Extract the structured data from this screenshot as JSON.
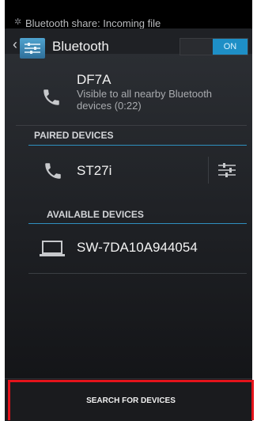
{
  "notification": {
    "text": "Bluetooth share: Incoming file",
    "icon": "bluetooth-share-icon"
  },
  "actionbar": {
    "title": "Bluetooth",
    "toggle_label": "ON",
    "icon": "bluetooth-settings-icon"
  },
  "this_device": {
    "name": "DF7A",
    "status": "Visible to all nearby Bluetooth devices (0:22)",
    "icon": "phone-icon"
  },
  "paired": {
    "header": "PAIRED DEVICES",
    "devices": [
      {
        "name": "ST27i",
        "icon": "phone-icon",
        "settings_icon": "device-settings-icon"
      }
    ]
  },
  "available": {
    "header": "AVAILABLE DEVICES",
    "devices": [
      {
        "name": "SW-7DA10A944054",
        "icon": "laptop-icon"
      }
    ]
  },
  "search_button": {
    "label": "SEARCH FOR DEVICES"
  },
  "colors": {
    "accent": "#1e8fc6",
    "highlight_border": "#e4131b",
    "background": "#1e2024"
  }
}
